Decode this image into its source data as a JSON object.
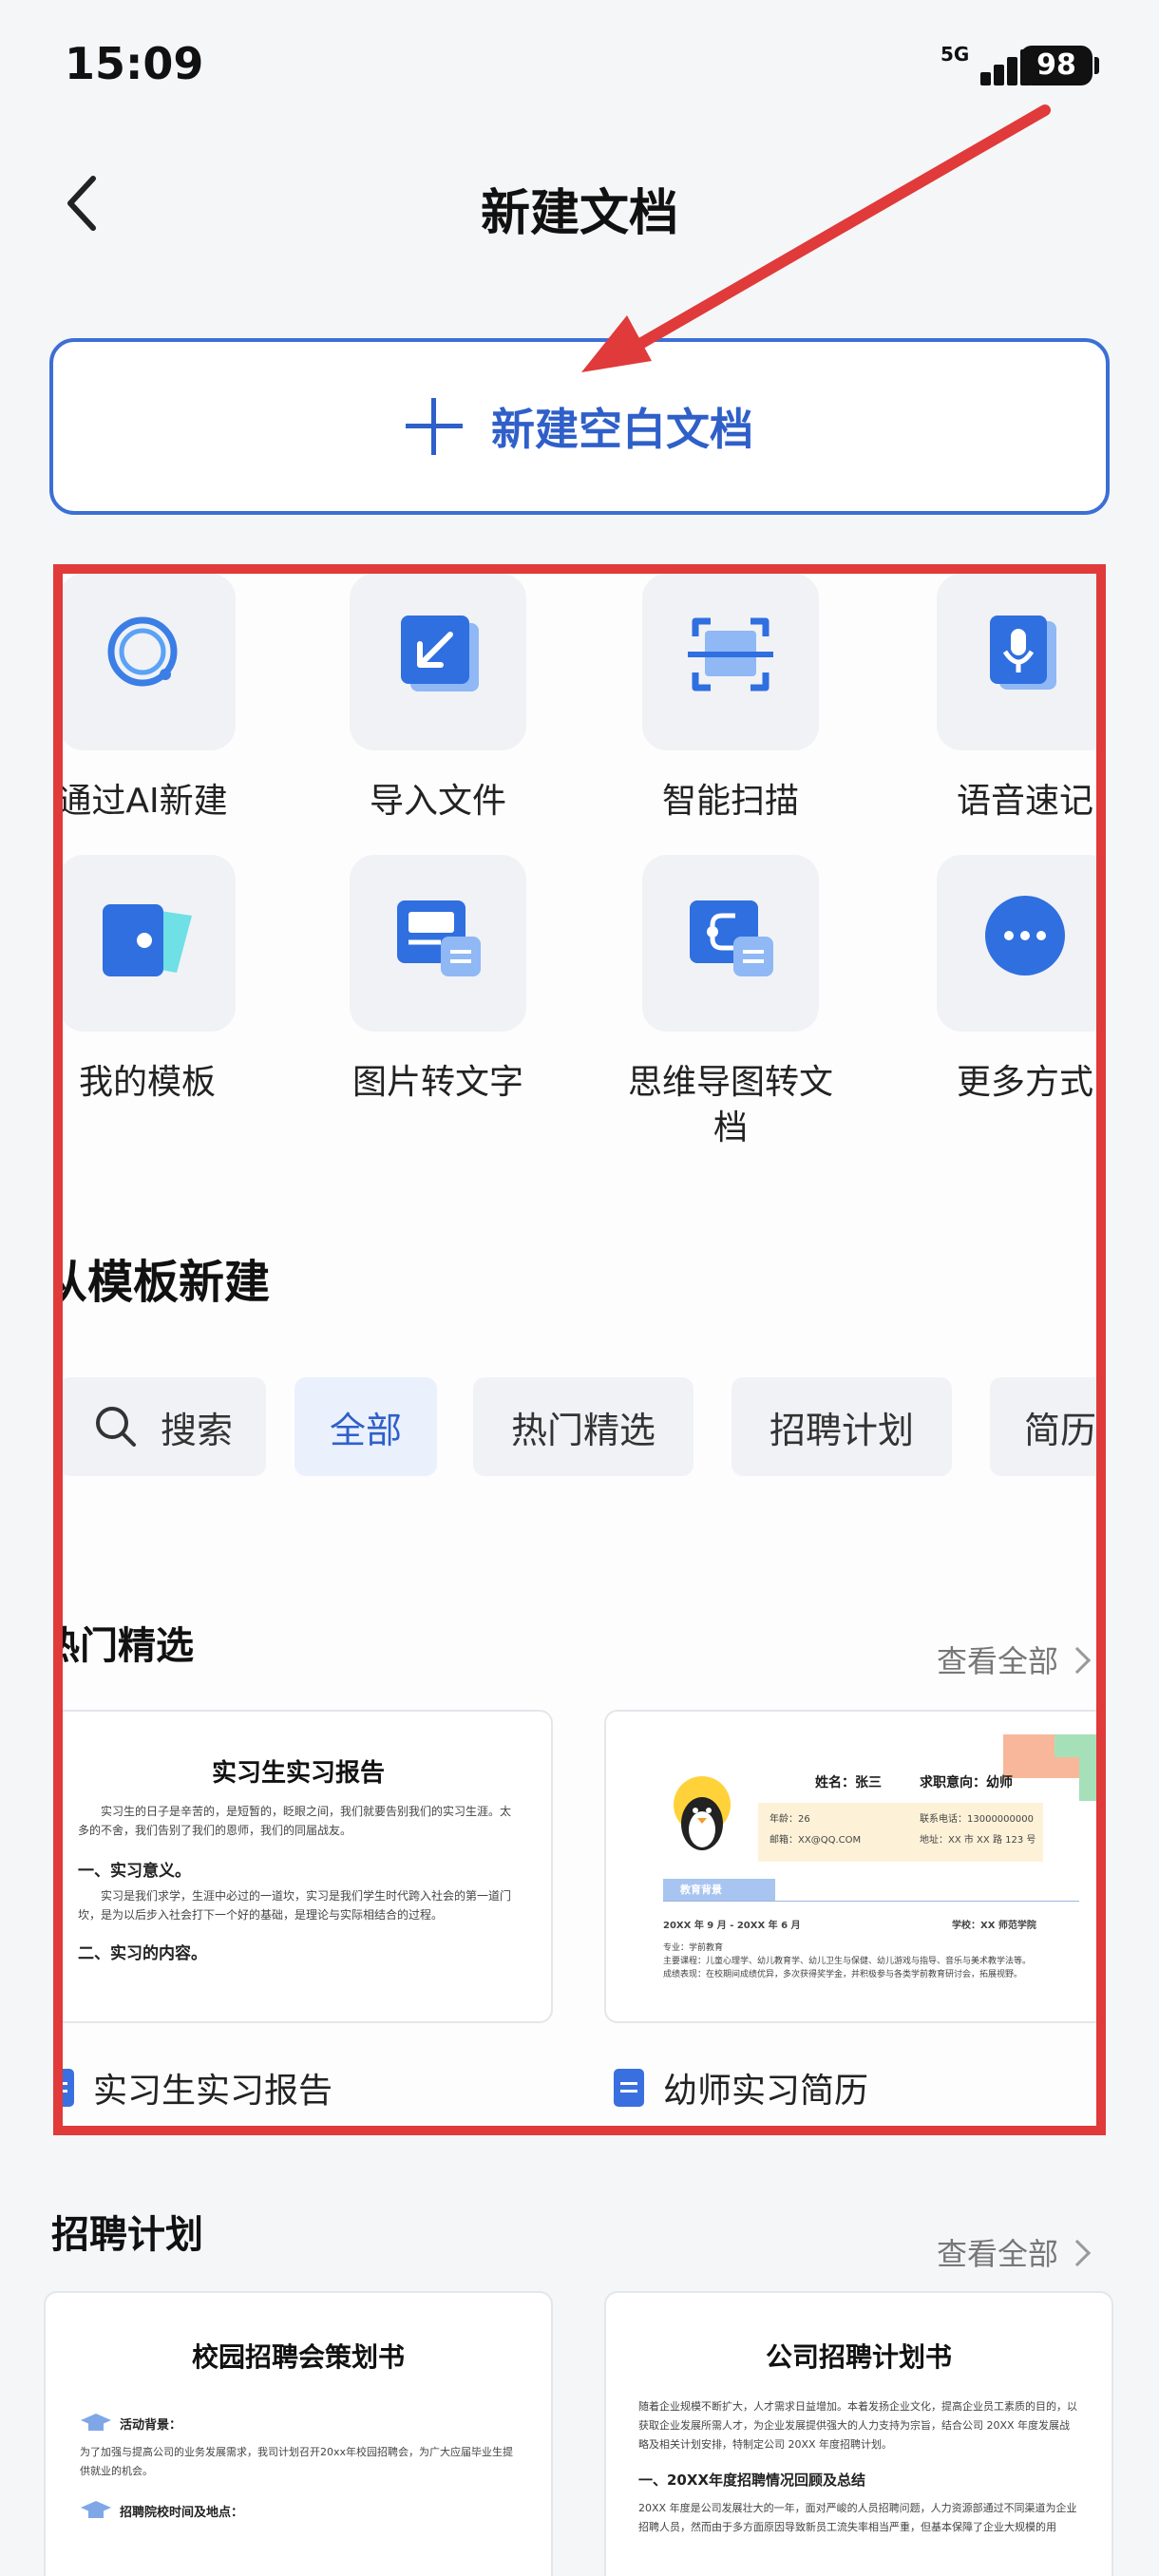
{
  "status": {
    "time": "15:09",
    "network": "5G",
    "battery": "98"
  },
  "header": {
    "title": "新建文档"
  },
  "new_blank": {
    "label": "新建空白文档"
  },
  "tools": [
    {
      "label": "通过AI新建",
      "icon": "ai-ring-icon"
    },
    {
      "label": "导入文件",
      "icon": "import-arrow-icon"
    },
    {
      "label": "智能扫描",
      "icon": "scan-frame-icon"
    },
    {
      "label": "语音速记",
      "icon": "microphone-icon"
    },
    {
      "label": "我的模板",
      "icon": "template-cards-icon"
    },
    {
      "label": "图片转文字",
      "icon": "image-to-text-icon"
    },
    {
      "label": "思维导图转文档",
      "icon": "mindmap-to-doc-icon"
    },
    {
      "label": "更多方式",
      "icon": "more-dots-icon"
    }
  ],
  "from_template": {
    "title": "从模板新建",
    "search_label": "搜索",
    "filters": [
      "全部",
      "热门精选",
      "招聘计划",
      "简历"
    ]
  },
  "hot": {
    "title": "热门精选",
    "see_all": "查看全部",
    "cards": [
      {
        "name": "实习生实习报告",
        "doc_title": "实习生实习报告",
        "intro": "实习生的日子是辛苦的，是短暂的，眨眼之间，我们就要告别我们的实习生涯。太多的不舍，我们告别了我们的恩师，我们的同届战友。",
        "h1": "一、实习意义。",
        "p1": "实习是我们求学，生涯中必过的一道坎，实习是我们学生时代跨入社会的第一道门坎，是为以后步入社会打下一个好的基础，是理论与实际相结合的过程。",
        "h2": "二、实习的内容。"
      },
      {
        "name": "幼师实习简历",
        "name_line": "姓名：张三",
        "intent": "求职意向：幼师",
        "age": "年龄：26",
        "phone": "联系电话：13000000000",
        "email": "邮箱：XX@QQ.COM",
        "address": "地址：XX 市 XX 路 123 号",
        "edu_heading": "教育背景",
        "period": "20XX 年 9 月 - 20XX 年 6 月",
        "school": "学校：XX 师范学院",
        "major": "专业：学前教育",
        "courses": "主要课程：儿童心理学、幼儿教育学、幼儿卫生与保健、幼儿游戏与指导、音乐与美术教学法等。",
        "grades": "成绩表现：在校期间成绩优异，多次获得奖学金，并积极参与各类学前教育研讨会，拓展视野。"
      }
    ]
  },
  "recruit": {
    "title": "招聘计划",
    "see_all": "查看全部",
    "cards": [
      {
        "doc_title": "校园招聘会策划书",
        "bg_label": "活动背景：",
        "bg_text": "为了加强与提高公司的业务发展需求，我司计划召开20xx年校园招聘会，为广大应届毕业生提供就业的机会。",
        "place_label": "招聘院校时间及地点："
      },
      {
        "doc_title": "公司招聘计划书",
        "intro": "随着企业规模不断扩大，人才需求日益增加。本着发扬企业文化，提高企业员工素质的目的，以获取企业发展所需人才，为企业发展提供强大的人力支持为宗旨，结合公司 20XX 年度发展战略及相关计划安排，特制定公司 20XX 年度招聘计划。",
        "h1": "一、20XX年度招聘情况回顾及总结",
        "p1": "20XX 年度是公司发展壮大的一年，面对严峻的人员招聘问题，人力资源部通过不同渠道为企业招聘人员，然而由于多方面原因导致新员工流失率相当严重，但基本保障了企业大规模的用"
      }
    ]
  },
  "colors": {
    "accent": "#2f5fc9",
    "annotation_red": "#e03a3a"
  }
}
